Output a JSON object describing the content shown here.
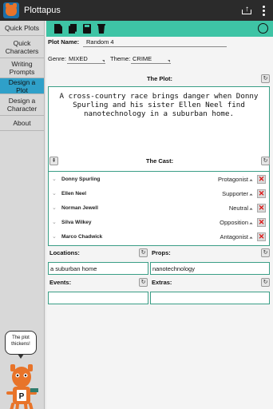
{
  "app": {
    "title": "Plottapus"
  },
  "sidebar": {
    "items": [
      {
        "label": "Quick Plots",
        "active": false
      },
      {
        "label": "Quick Characters",
        "active": false
      },
      {
        "label": "Writing Prompts",
        "active": false
      },
      {
        "label": "Design a Plot",
        "active": true
      },
      {
        "label": "Design a Character",
        "active": false
      },
      {
        "label": "About",
        "active": false
      }
    ],
    "mascot_bubble": "The plot thickens!"
  },
  "toolbar": {
    "icons": [
      "new-document-icon",
      "copy-document-icon",
      "save-icon",
      "trash-icon",
      "dice-icon"
    ],
    "color": "#3ec4a5"
  },
  "form": {
    "plot_name_label": "Plot Name:",
    "plot_name_value": "Random 4",
    "genre_label": "Genre:",
    "genre_value": "MIXED",
    "theme_label": "Theme:",
    "theme_value": "CRIME"
  },
  "plot": {
    "title": "The Plot:",
    "text": "A cross-country race brings danger when Donny Spurling and his sister Ellen Neel find nanotechnology in a suburban home."
  },
  "cast": {
    "title": "The Cast:",
    "members": [
      {
        "name": "Donny Spurling",
        "role": "Protagonist"
      },
      {
        "name": "Ellen Neel",
        "role": "Supporter"
      },
      {
        "name": "Norman Jewell",
        "role": "Neutral"
      },
      {
        "name": "Silva Wilkey",
        "role": "Opposition"
      },
      {
        "name": "Marco Chadwick",
        "role": "Antagonist"
      }
    ]
  },
  "details": {
    "locations_label": "Locations:",
    "locations_value": "a suburban home",
    "props_label": "Props:",
    "props_value": "nanotechnology",
    "events_label": "Events:",
    "events_value": "",
    "extras_label": "Extras:",
    "extras_value": ""
  },
  "colors": {
    "accent": "#3ec4a5",
    "active_nav": "#2fa0c9",
    "delete": "#dd1111"
  }
}
